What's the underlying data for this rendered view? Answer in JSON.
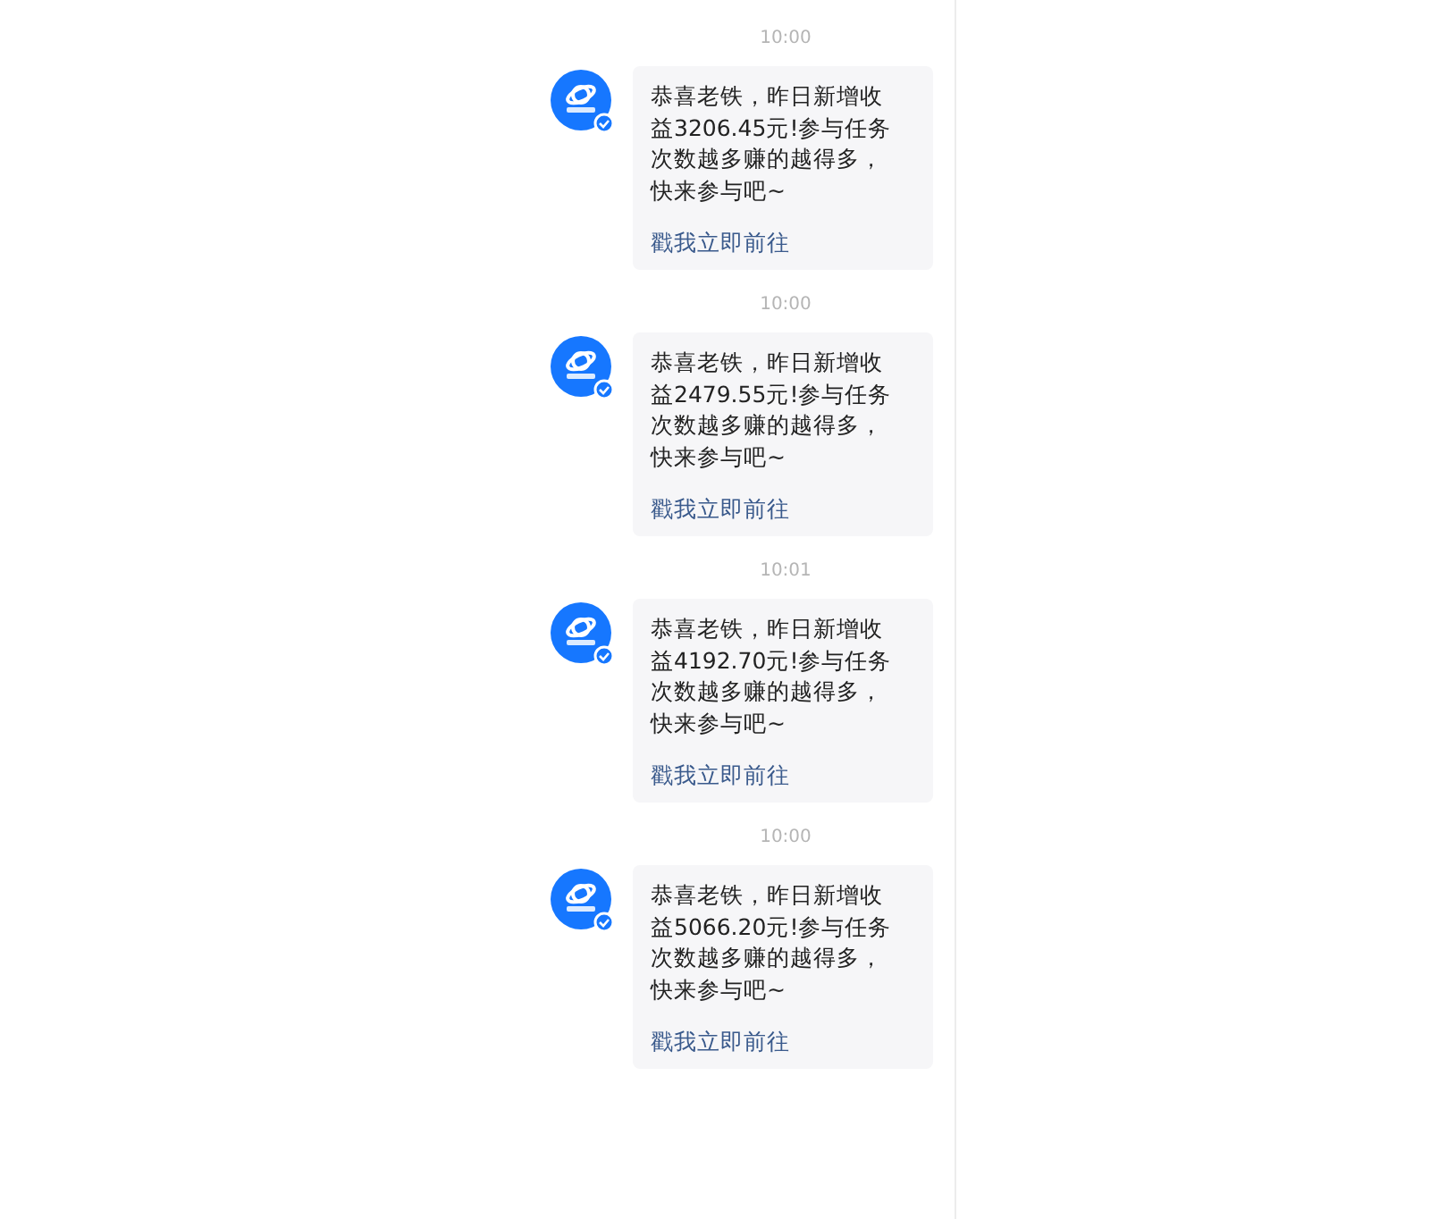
{
  "messages": [
    {
      "time": "10:00",
      "text": "恭喜老铁，昨日新增收益3206.45元!参与任务次数越多赚的越得多，快来参与吧~",
      "link": "戳我立即前往"
    },
    {
      "time": "10:00",
      "text": "恭喜老铁，昨日新增收益2479.55元!参与任务次数越多赚的越得多，快来参与吧~",
      "link": "戳我立即前往"
    },
    {
      "time": "10:01",
      "text": "恭喜老铁，昨日新增收益4192.70元!参与任务次数越多赚的越得多，快来参与吧~",
      "link": "戳我立即前往"
    },
    {
      "time": "10:00",
      "text": "恭喜老铁，昨日新增收益5066.20元!参与任务次数越多赚的越得多，快来参与吧~",
      "link": "戳我立即前往"
    }
  ]
}
